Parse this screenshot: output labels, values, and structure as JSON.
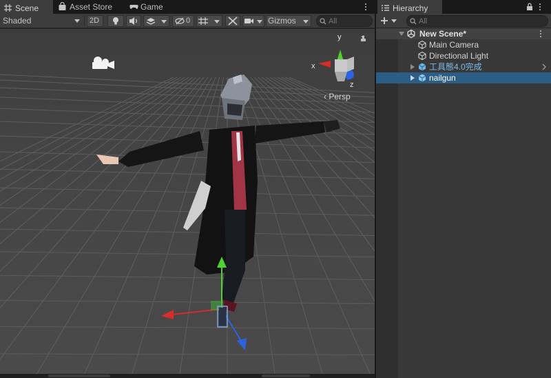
{
  "scene_panel": {
    "tabs": [
      {
        "label": "Scene",
        "icon": "grid-icon",
        "active": true
      },
      {
        "label": "Asset Store",
        "icon": "shopping-bag-icon",
        "active": false
      },
      {
        "label": "Game",
        "icon": "gamepad-icon",
        "active": false
      }
    ],
    "toolbar": {
      "shading_mode": "Shaded",
      "mode_2d": "2D",
      "hidden_objects_count": "0",
      "gizmos_label": "Gizmos",
      "search_placeholder": "All"
    },
    "viewport": {
      "projection_label": "Persp",
      "orientation_gizmo": {
        "x": "x",
        "y": "y",
        "z": "z"
      }
    }
  },
  "hierarchy_panel": {
    "tab_label": "Hierarchy",
    "search_placeholder": "All",
    "scene_name": "New Scene*",
    "items": [
      {
        "label": "Main Camera",
        "icon": "gameobject-icon",
        "selected": false,
        "has_children": false
      },
      {
        "label": "Directional Light",
        "icon": "gameobject-icon",
        "selected": false,
        "has_children": false
      },
      {
        "label": "工具態4.0完成",
        "icon": "prefab-icon",
        "selected": false,
        "has_children": true
      },
      {
        "label": "nailgun",
        "icon": "prefab-icon",
        "selected": true,
        "has_children": true
      }
    ]
  },
  "colors": {
    "selection": "#2c5d87",
    "axis_x": "#d62c2c",
    "axis_y": "#4fd12e",
    "axis_z": "#2c62e0",
    "prefab_blue": "#6fb5e6"
  }
}
